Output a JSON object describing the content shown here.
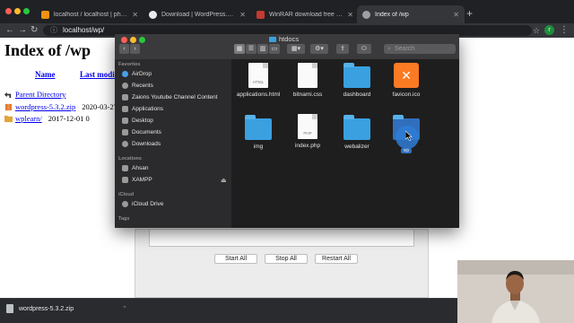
{
  "browser": {
    "tabs": [
      {
        "title": "localhost / localhost | phpMyAdmin",
        "fav_color": "#f29111",
        "active": false
      },
      {
        "title": "Download | WordPress.org",
        "fav_color": "#e8eaed",
        "active": false
      },
      {
        "title": "WinRAR download free and support",
        "fav_color": "#c43a31",
        "active": false
      },
      {
        "title": "Index of /wp",
        "fav_color": "#9aa0a6",
        "active": true
      }
    ],
    "new_tab": "+",
    "address": "localhost/wp/",
    "profile_initial": "r"
  },
  "page": {
    "title": "Index of /wp",
    "columns": [
      "Name",
      "Last modified"
    ],
    "rows": [
      {
        "name": "Parent Directory",
        "date": ""
      },
      {
        "name": "wordpress-5.3.2.zip",
        "date": "2020-03-27 1"
      },
      {
        "name": "wplearn/",
        "date": "2017-12-01 0"
      }
    ]
  },
  "xampp": {
    "buttons": [
      "Start All",
      "Stop All",
      "Restart All"
    ]
  },
  "finder": {
    "title": "htdocs",
    "search_placeholder": "Search",
    "sidebar": {
      "favorites_label": "Favorites",
      "favorites": [
        "AirDrop",
        "Recents",
        "Zaions Youtube Channel Content",
        "Applications",
        "Desktop",
        "Documents",
        "Downloads"
      ],
      "locations_label": "Locations",
      "locations": [
        "Ahsan",
        "XAMPP"
      ],
      "icloud_label": "iCloud",
      "icloud": [
        "iCloud Drive"
      ],
      "tags_label": "Tags"
    },
    "items": [
      {
        "name": "applications.html",
        "kind": "doc",
        "badge": "HTML"
      },
      {
        "name": "bitnami.css",
        "kind": "doc",
        "badge": ""
      },
      {
        "name": "dashboard",
        "kind": "folder",
        "badge": ""
      },
      {
        "name": "favicon.ico",
        "kind": "xampp",
        "badge": ""
      },
      {
        "name": "img",
        "kind": "folder",
        "badge": ""
      },
      {
        "name": "index.php",
        "kind": "doc",
        "badge": "PHP"
      },
      {
        "name": "webalizer",
        "kind": "folder",
        "badge": ""
      },
      {
        "name": "wp",
        "kind": "folder",
        "badge": ""
      }
    ]
  },
  "downloads": {
    "file": "wordpress-5.3.2.zip"
  }
}
